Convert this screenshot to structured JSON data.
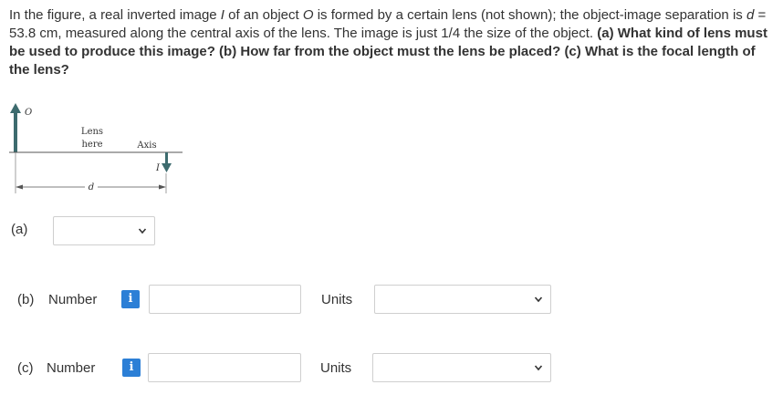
{
  "question": {
    "p1": "In the figure, a real inverted image ",
    "var_I": "I",
    "p2": " of an object ",
    "var_O": "O",
    "p3": " is formed by a certain lens (not shown); the object-image separation is ",
    "var_d": "d",
    "p4": " = 53.8 cm, measured along the central axis of the lens. The image is just 1/4 the size of the object. ",
    "a_tag": "(a)",
    "a_text": " What kind of lens must be used to produce this image? ",
    "b_tag": "(b)",
    "b_text": " How far from the object must the lens be placed? ",
    "c_tag": "(c)",
    "c_text": " What is the focal length of the lens?"
  },
  "figure": {
    "object_label": "O",
    "lens_label_1": "Lens",
    "lens_label_2": "here",
    "axis_label": "Axis",
    "image_label": "I",
    "distance_label": "d"
  },
  "part_a": {
    "label": "(a)",
    "selected": ""
  },
  "part_b": {
    "label": "(b)",
    "number_label": "Number",
    "info_icon": "i",
    "value": "",
    "units_label": "Units",
    "units_selected": ""
  },
  "part_c": {
    "label": "(c)",
    "number_label": "Number",
    "info_icon": "i",
    "value": "",
    "units_label": "Units",
    "units_selected": ""
  },
  "colors": {
    "info_blue": "#2c7fd6",
    "border": "#cfcfcf",
    "arrow": "#3d6b6e"
  }
}
